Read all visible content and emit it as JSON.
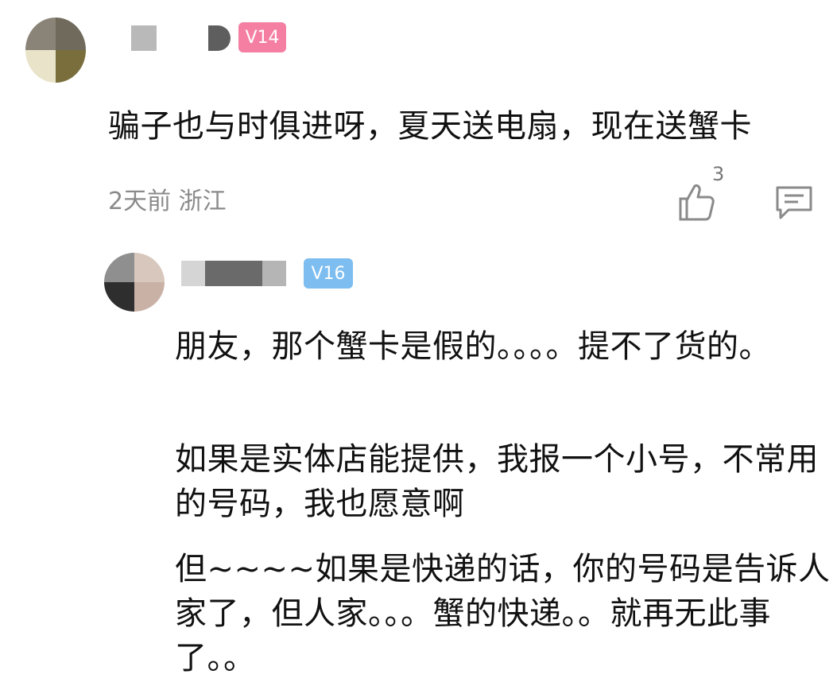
{
  "comment": {
    "badge": "V14",
    "text": "骗子也与时俱进呀，夏天送电扇，现在送蟹卡",
    "meta": "2天前 浙江",
    "like_count": "3",
    "like_icon": "thumbs-up-icon",
    "reply_icon": "comment-icon"
  },
  "reply": {
    "badge": "V16",
    "paragraphs": [
      "朋友，那个蟹卡是假的。。。。提不了货的。",
      "如果是实体店能提供，我报一个小号，不常用的号码，我也愿意啊",
      "但~~~~如果是快递的话，你的号码是告诉人家了，但人家。。。蟹的快递。。就再无此事了。。"
    ]
  },
  "colors": {
    "badge_v14": "#f47fa3",
    "badge_v16": "#7dbdf0",
    "meta_gray": "#8a8a8a"
  }
}
